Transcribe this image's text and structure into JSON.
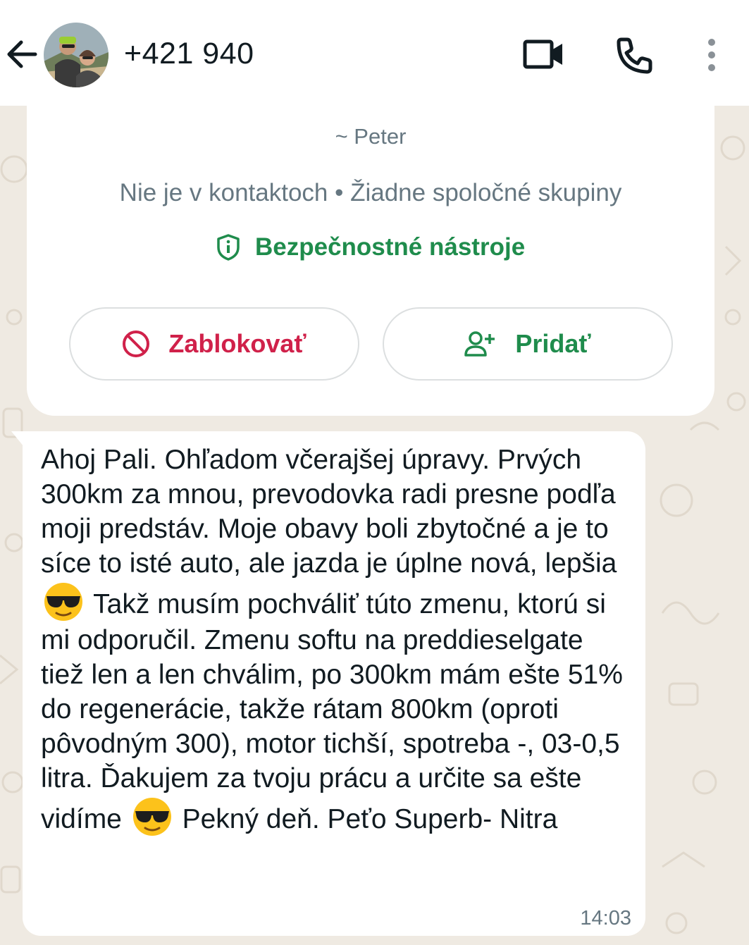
{
  "header": {
    "contact_name": "+421 940"
  },
  "info_card": {
    "sender_name": "~ Peter",
    "meta": "Nie je v kontaktoch • Žiadne spoločné skupiny",
    "safety_tools_label": "Bezpečnostné nástroje",
    "block_label": "Zablokovať",
    "add_label": "Pridať"
  },
  "message": {
    "part1": "Ahoj Pali. Ohľadom včerajšej úpravy. Prvých 300km za mnou, prevodovka radi presne podľa moji predstáv. Moje obavy boli zbytočné a je to síce to isté auto, ale jazda je úplne nová, lepšia",
    "part2": "Takž musím pochváliť túto zmenu, ktorú si mi odporučil. Zmenu softu na preddieselgate tiež len a len chválim, po 300km mám ešte 51% do regenerácie, takže rátam 800km (oproti pôvodným 300), motor tichší, spotreba -, 03-0,5 litra. Ďakujem za tvoju prácu a určite sa ešte vidíme",
    "part3": "Pekný deň. Peťo Superb- Nitra",
    "time": "14:03",
    "emoji_icon": "smiling-face-with-sunglasses"
  },
  "colors": {
    "accent_green": "#1f8c4c",
    "block_red": "#d0214a",
    "wallpaper": "#efeae2",
    "secondary_text": "#667781"
  }
}
